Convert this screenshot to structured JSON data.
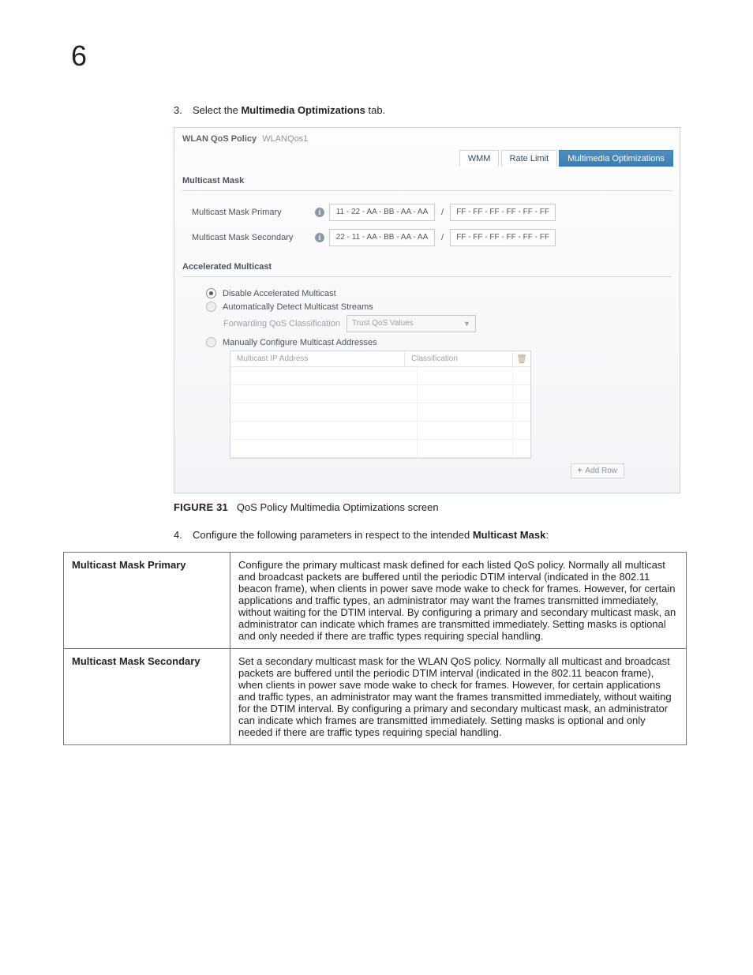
{
  "page": {
    "chapter_number": "6"
  },
  "steps": {
    "s3_num": "3.",
    "s3_pre": "Select the ",
    "s3_bold": "Multimedia Optimizations",
    "s3_post": " tab.",
    "s4_num": "4.",
    "s4_pre": "Configure the following parameters in respect to the intended ",
    "s4_bold": "Multicast Mask",
    "s4_post": ":"
  },
  "panel": {
    "title_prefix": "WLAN QoS Policy",
    "title_name": "WLANQos1",
    "tabs": {
      "wmm": "WMM",
      "rate_limit": "Rate Limit",
      "multimedia": "Multimedia Optimizations"
    },
    "multicast_mask": {
      "legend": "Multicast Mask",
      "primary_label": "Multicast Mask Primary",
      "primary_mac": "11 - 22 - AA - BB - AA - AA",
      "primary_mask": "FF - FF - FF - FF - FF - FF",
      "secondary_label": "Multicast Mask Secondary",
      "secondary_mac": "22 - 11 - AA - BB - AA - AA",
      "secondary_mask": "FF - FF - FF - FF - FF - FF"
    },
    "accel": {
      "legend": "Accelerated Multicast",
      "opt_disable": "Disable Accelerated Multicast",
      "opt_auto": "Automatically Detect Multicast Streams",
      "fwd_label": "Forwarding QoS Classification",
      "fwd_value": "Trust QoS Values",
      "opt_manual": "Manually Configure Multicast Addresses",
      "grid": {
        "col_ip": "Multicast IP Address",
        "col_class": "Classification"
      },
      "add_row": "Add Row"
    }
  },
  "figure": {
    "label": "FIGURE 31",
    "caption": "QoS Policy Multimedia Optimizations screen"
  },
  "table": {
    "row1_name": "Multicast Mask Primary",
    "row1_desc": "Configure the primary multicast mask defined for each listed QoS policy. Normally all multicast and broadcast packets are buffered until the periodic DTIM interval (indicated in the 802.11 beacon frame), when clients in power save mode wake to check for frames. However, for certain applications and traffic types, an administrator may want the frames transmitted immediately, without waiting for the DTIM interval. By configuring a primary and secondary multicast mask, an administrator can indicate which frames are transmitted immediately. Setting masks is optional and only needed if there are traffic types requiring special handling.",
    "row2_name": "Multicast Mask Secondary",
    "row2_desc": "Set a secondary multicast mask for the WLAN QoS policy. Normally all multicast and broadcast packets are buffered until the periodic DTIM interval (indicated in the 802.11 beacon frame), when clients in power save mode wake to check for frames. However, for certain applications and traffic types, an administrator may want the frames transmitted immediately, without waiting for the DTIM interval. By configuring a primary and secondary multicast mask, an administrator can indicate which frames are transmitted immediately. Setting masks is optional and only needed if there are traffic types requiring special handling."
  }
}
